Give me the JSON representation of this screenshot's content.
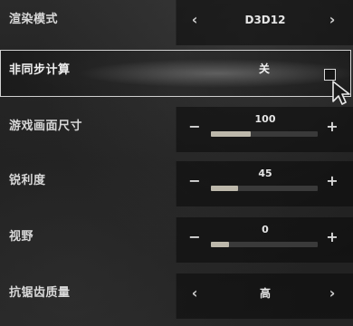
{
  "settings": [
    {
      "label": "渲染模式",
      "type": "select",
      "value": "D3D12",
      "left_arrow": "‹",
      "right_arrow": "›"
    },
    {
      "label": "非同步计算",
      "type": "toggle",
      "value": "关",
      "checked": false
    },
    {
      "label": "游戏画面尺寸",
      "type": "slider",
      "value": "100",
      "fraction": 0.37,
      "minus": "−",
      "plus": "+"
    },
    {
      "label": "锐利度",
      "type": "slider",
      "value": "45",
      "fraction": 0.25,
      "minus": "−",
      "plus": "+"
    },
    {
      "label": "视野",
      "type": "slider",
      "value": "0",
      "fraction": 0.17,
      "minus": "−",
      "plus": "+"
    },
    {
      "label": "抗锯齿质量",
      "type": "select",
      "value": "高",
      "left_arrow": "‹",
      "right_arrow": "›"
    }
  ],
  "colors": {
    "slider_fill": "#bdb8ab",
    "slider_track": "#3a3a3a",
    "highlight_border": "#cfcfcf"
  },
  "icons": {
    "cursor": "mouse-pointer-icon"
  }
}
